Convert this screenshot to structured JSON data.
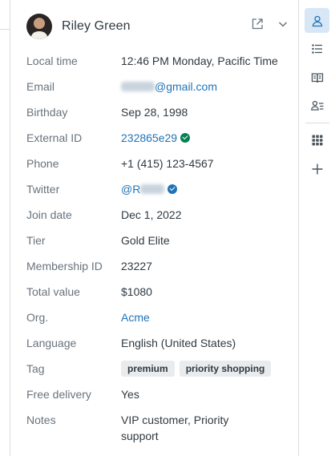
{
  "header": {
    "name": "Riley Green",
    "open_icon": "external-link-icon",
    "collapse_icon": "chevron-down-icon"
  },
  "fields": {
    "local_time": {
      "label": "Local time",
      "value": "12:46 PM Monday, Pacific Time"
    },
    "email": {
      "label": "Email",
      "value": "@gmail.com"
    },
    "birthday": {
      "label": "Birthday",
      "value": "Sep 28, 1998"
    },
    "external_id": {
      "label": "External ID",
      "value": "232865e29"
    },
    "phone": {
      "label": "Phone",
      "value": "+1 (415) 123-4567"
    },
    "twitter": {
      "label": "Twitter",
      "value": "@R"
    },
    "join_date": {
      "label": "Join date",
      "value": "Dec 1, 2022"
    },
    "tier": {
      "label": "Tier",
      "value": "Gold Elite"
    },
    "membership_id": {
      "label": "Membership ID",
      "value": "23227"
    },
    "total_value": {
      "label": "Total value",
      "value": "$1080"
    },
    "org": {
      "label": "Org.",
      "value": "Acme"
    },
    "language": {
      "label": "Language",
      "value": "English (United States)"
    },
    "tag": {
      "label": "Tag",
      "values": [
        "premium",
        "priority shopping"
      ]
    },
    "free_delivery": {
      "label": "Free delivery",
      "value": "Yes"
    },
    "notes": {
      "label": "Notes",
      "value": "VIP customer, Priority support"
    }
  },
  "rail": {
    "items": [
      "user-icon",
      "list-icon",
      "book-icon",
      "user-list-icon",
      "apps-grid-icon",
      "plus-icon"
    ]
  },
  "colors": {
    "link": "#1f73b7",
    "verified_green": "#038153",
    "verified_blue": "#1f73b7",
    "active_rail_bg": "#d8e7f5"
  }
}
